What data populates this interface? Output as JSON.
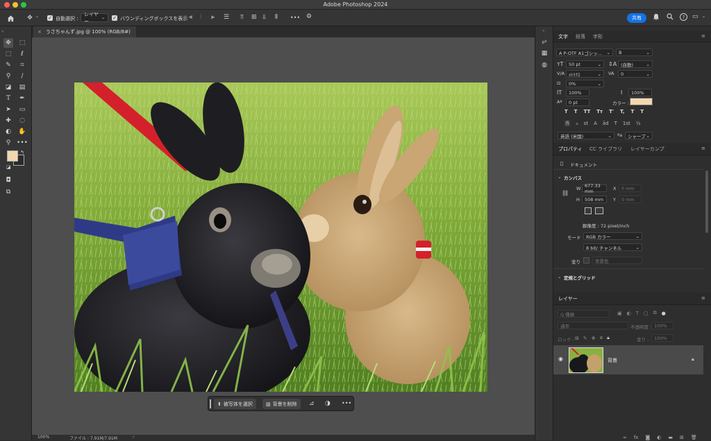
{
  "app": {
    "title": "Adobe Photoshop 2024"
  },
  "options_bar": {
    "auto_select_label": "自動選択 :",
    "layer_select": "レイヤー",
    "show_bbox_label": "バウンディングボックスを表示",
    "share_label": "共有",
    "more": "•••"
  },
  "document": {
    "tab_title": "うさちゃんず.jpg @ 100% (RGB/8#)"
  },
  "context_bar": {
    "select_subject": "被写体を選択",
    "remove_bg": "背景を削除",
    "more": "•••"
  },
  "status": {
    "zoom": "100%",
    "file": "ファイル : 7.91M/7.91M"
  },
  "char_panel": {
    "tabs": [
      "文字",
      "段落",
      "字形"
    ],
    "font_family": "A P-OTF A1ゴシッ...",
    "font_style": "B",
    "font_size": "50 pt",
    "leading": "(自動)",
    "kerning": "ﾒﾄﾘｸｽ",
    "tracking": "0",
    "tsume": "0%",
    "vscale": "100%",
    "hscale": "100%",
    "baseline": "0 pt",
    "color_label": "カラー :",
    "color": "#f2d7ae",
    "language": "英語 (米国)",
    "aa_label": "ªa",
    "antialias": "シャープ",
    "styles": [
      "T",
      "T",
      "TT",
      "Tт",
      "T'",
      "T,",
      "T",
      "T"
    ],
    "opentype": [
      "fi",
      "ℴ",
      "st",
      "A",
      "ād",
      "T",
      "1st",
      "½"
    ]
  },
  "props_panel": {
    "tabs": [
      "プロパティ",
      "CC ライブラリ",
      "レイヤーカンプ"
    ],
    "doc_label": "ドキュメント",
    "canvas_header": "カンバス",
    "w_label": "W",
    "w_value": "677.33 mm",
    "h_label": "H",
    "h_value": "508 mm",
    "x_label": "X",
    "x_placeholder": "0 mm",
    "y_label": "Y",
    "y_placeholder": "0 mm",
    "resolution": "解像度 : 72 pixel/inch",
    "mode_label": "モード",
    "mode": "RGB カラー",
    "depth": "8 bit/ チャンネル",
    "fill_label": "塗り",
    "fill_value": "背景色",
    "guides_header": "定規とグリッド"
  },
  "layers_panel": {
    "tab": "レイヤー",
    "search": "Q 種類",
    "blend": "通常",
    "opacity_label": "不透明度 :",
    "opacity": "100%",
    "lock_label": "ロック :",
    "fill_label": "塗り :",
    "fill": "100%",
    "layer_name": "背景"
  },
  "icons": {
    "home": "home-icon",
    "move": "move-icon",
    "search": "search-icon",
    "help": "help-icon",
    "bell": "bell-icon",
    "eye": "eye-icon",
    "lock": "lock-icon"
  },
  "colors": {
    "accent": "#1473e6",
    "foreground_swatch": "#f2d7ae",
    "background_swatch": "#2b2b2b"
  }
}
